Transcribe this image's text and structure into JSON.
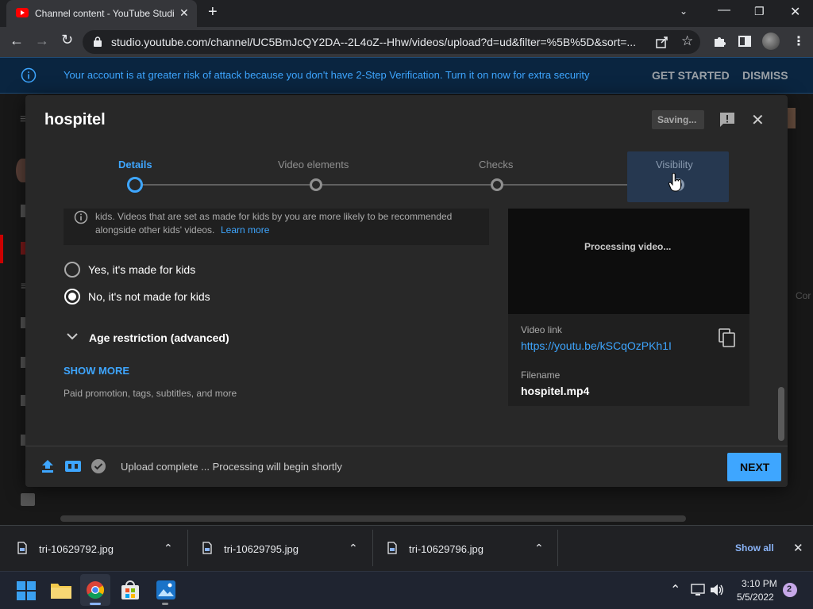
{
  "browser": {
    "tab_title": "Channel content - YouTube Studi",
    "url": "studio.youtube.com/channel/UC5BmJcQY2DA--2L4oZ--Hhw/videos/upload?d=ud&filter=%5B%5D&sort=..."
  },
  "banner": {
    "message": "Your account is at greater risk of attack because you don't have 2-Step Verification. Turn it on now for extra security",
    "get_started": "GET STARTED",
    "dismiss": "DISMISS"
  },
  "dialog": {
    "title": "hospitel",
    "saving": "Saving...",
    "steps": [
      "Details",
      "Video elements",
      "Checks",
      "Visibility"
    ],
    "kids_notice": "kids. Videos that are set as made for kids by you are more likely to be recommended",
    "kids_notice_2": "alongside other kids' videos.",
    "learn_more": "Learn more",
    "radio_yes": "Yes, it's made for kids",
    "radio_no": "No, it's not made for kids",
    "age_restriction": "Age restriction (advanced)",
    "show_more": "SHOW MORE",
    "show_more_desc": "Paid promotion, tags, subtitles, and more",
    "processing": "Processing video...",
    "video_link_label": "Video link",
    "video_link": "https://youtu.be/kSCqOzPKh1I",
    "filename_label": "Filename",
    "filename": "hospitel.mp4",
    "footer_status": "Upload complete ... Processing will begin shortly",
    "next": "NEXT"
  },
  "side_text": "Cor",
  "downloads": {
    "items": [
      "tri-10629792.jpg",
      "tri-10629795.jpg",
      "tri-10629796.jpg"
    ],
    "show_all": "Show all"
  },
  "taskbar": {
    "time": "3:10 PM",
    "date": "5/5/2022",
    "notifications": "2"
  },
  "colors": {
    "accent": "#3ea6ff",
    "next_bg": "#3ea6ff",
    "banner_text": "#3ea6ff"
  }
}
